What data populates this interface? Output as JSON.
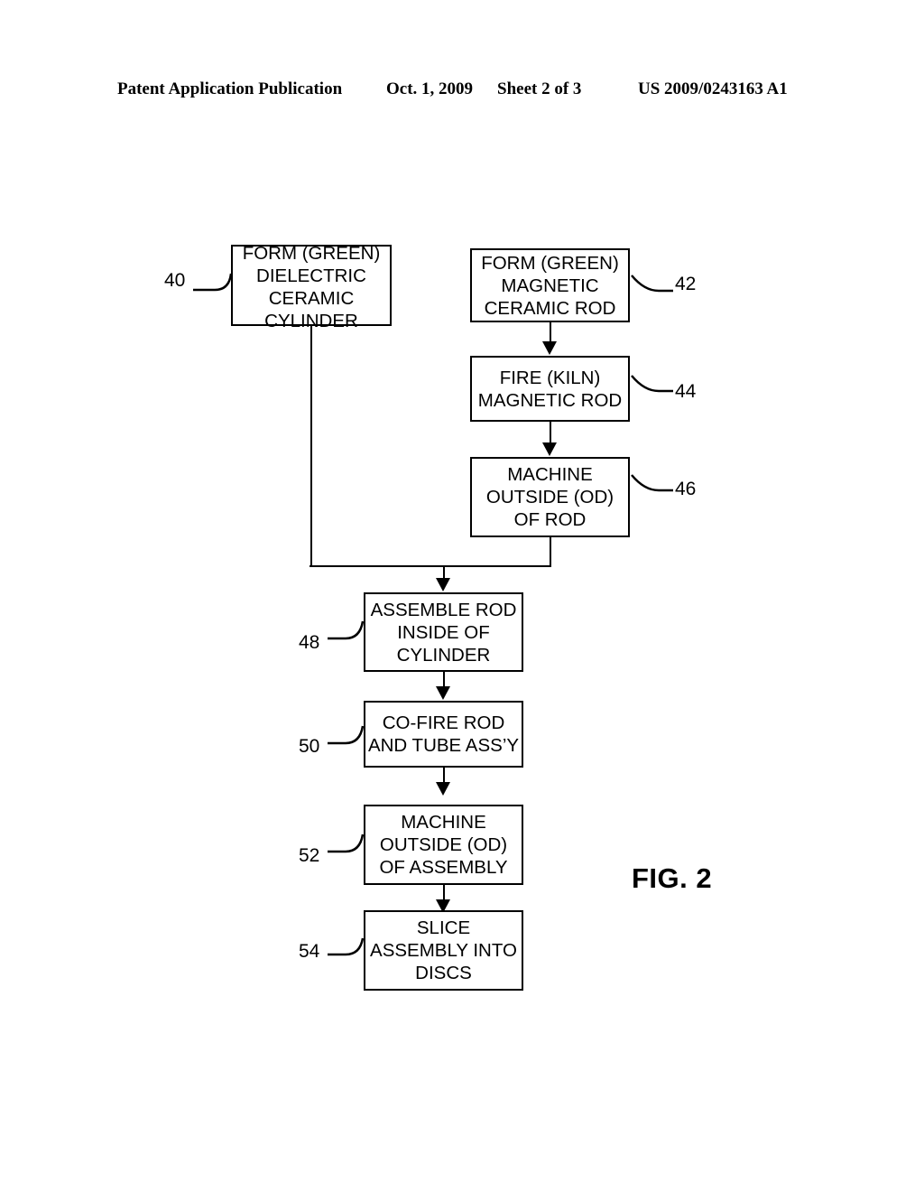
{
  "header": {
    "publication": "Patent Application Publication",
    "date": "Oct. 1, 2009",
    "sheet": "Sheet 2 of 3",
    "number": "US 2009/0243163 A1"
  },
  "figure": {
    "caption": "FIG. 2",
    "type": "process-flowchart",
    "boxes": [
      {
        "ref": "40",
        "ref_side": "left",
        "lines": [
          "FORM (GREEN)",
          "DIELECTRIC",
          "CERAMIC",
          "CYLINDER"
        ]
      },
      {
        "ref": "42",
        "ref_side": "right",
        "lines": [
          "FORM (GREEN)",
          "MAGNETIC",
          "CERAMIC ROD"
        ]
      },
      {
        "ref": "44",
        "ref_side": "right",
        "lines": [
          "FIRE (KILN)",
          "MAGNETIC ROD"
        ]
      },
      {
        "ref": "46",
        "ref_side": "right",
        "lines": [
          "MACHINE",
          "OUTSIDE (OD)",
          "OF ROD"
        ]
      },
      {
        "ref": "48",
        "ref_side": "left",
        "lines": [
          "ASSEMBLE ROD",
          "INSIDE OF",
          "CYLINDER"
        ]
      },
      {
        "ref": "50",
        "ref_side": "left",
        "lines": [
          "CO-FIRE ROD",
          "AND TUBE ASS’Y"
        ]
      },
      {
        "ref": "52",
        "ref_side": "left",
        "lines": [
          "MACHINE",
          "OUTSIDE (OD)",
          "OF ASSEMBLY"
        ]
      },
      {
        "ref": "54",
        "ref_side": "left",
        "lines": [
          "SLICE",
          "ASSEMBLY INTO",
          "DISCS"
        ]
      }
    ],
    "flow": [
      "40 → 48",
      "42 → 44",
      "44 → 46",
      "46 → 48",
      "48 → 50",
      "50 → 52",
      "52 → 54"
    ],
    "line_color": "#000000"
  }
}
